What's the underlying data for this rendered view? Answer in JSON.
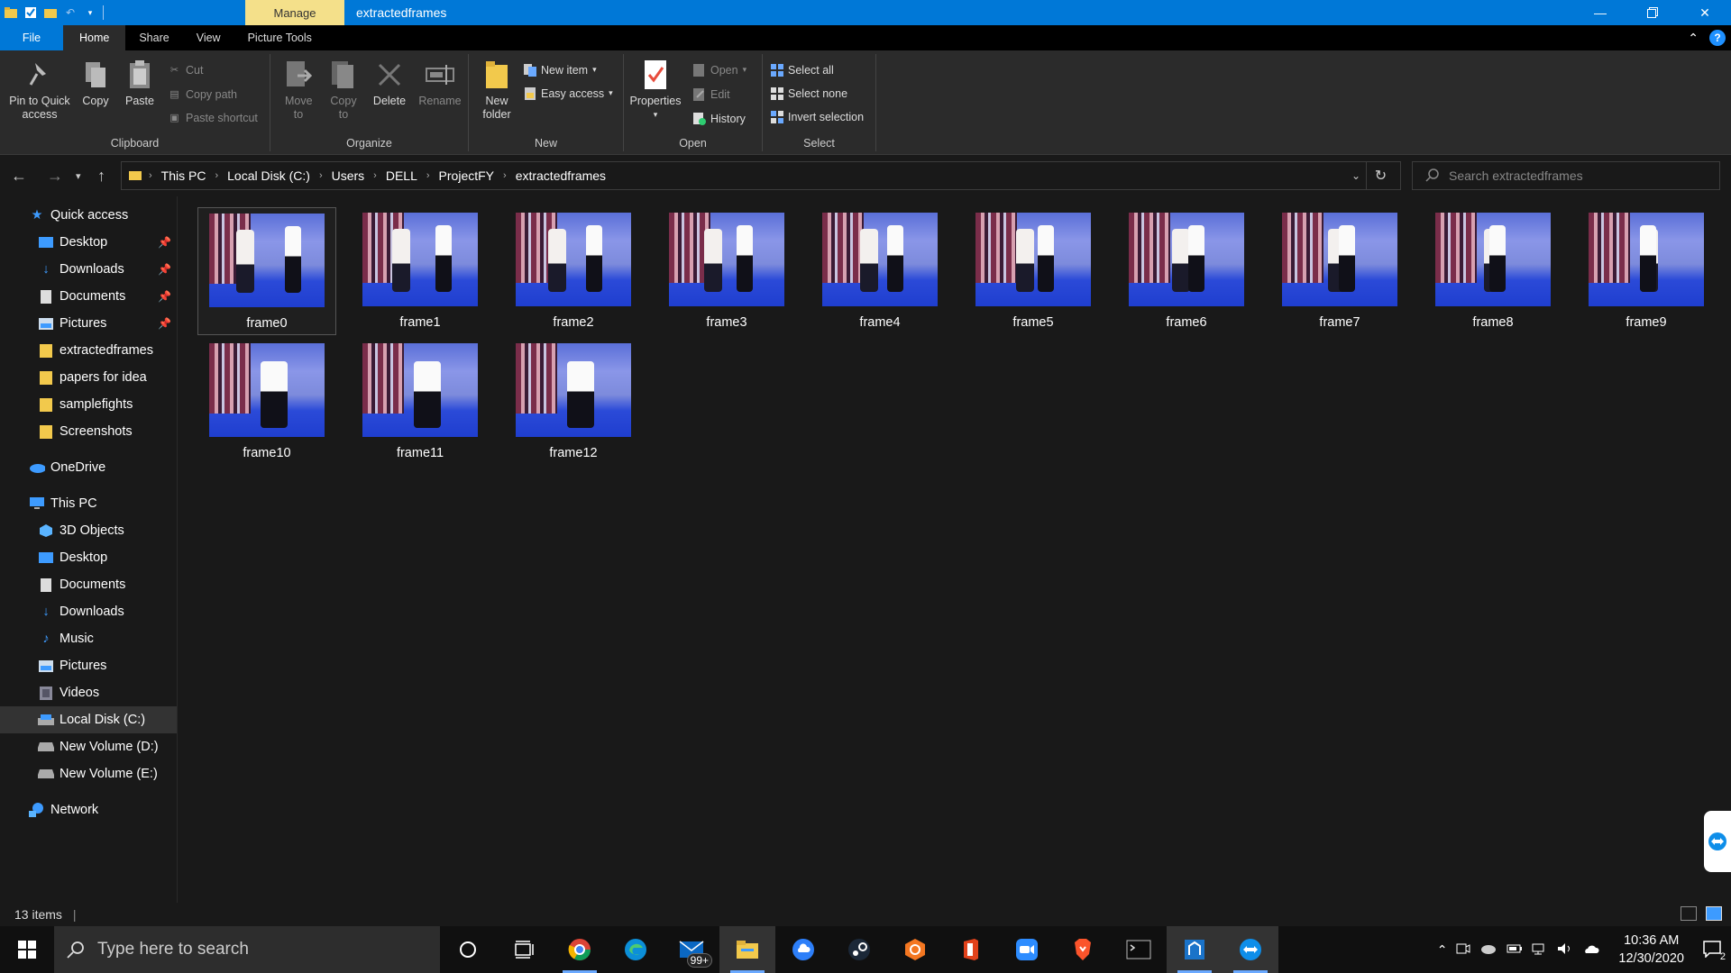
{
  "titlebar": {
    "manage_label": "Manage",
    "title": "extractedframes"
  },
  "ribbon_tabs": [
    "File",
    "Home",
    "Share",
    "View",
    "Picture Tools"
  ],
  "ribbon": {
    "clipboard": {
      "pin_label": "Pin to Quick access",
      "copy_label": "Copy",
      "paste_label": "Paste",
      "cut_label": "Cut",
      "copy_path_label": "Copy path",
      "paste_shortcut_label": "Paste shortcut",
      "group_label": "Clipboard"
    },
    "organize": {
      "move_to_label": "Move to",
      "copy_to_label": "Copy to",
      "delete_label": "Delete",
      "rename_label": "Rename",
      "group_label": "Organize"
    },
    "new": {
      "new_folder_label": "New folder",
      "new_item_label": "New item",
      "easy_access_label": "Easy access",
      "group_label": "New"
    },
    "open": {
      "properties_label": "Properties",
      "open_label": "Open",
      "edit_label": "Edit",
      "history_label": "History",
      "group_label": "Open"
    },
    "select": {
      "select_all_label": "Select all",
      "select_none_label": "Select none",
      "invert_label": "Invert selection",
      "group_label": "Select"
    }
  },
  "address": {
    "crumbs": [
      "This PC",
      "Local Disk (C:)",
      "Users",
      "DELL",
      "ProjectFY",
      "extractedframes"
    ],
    "search_placeholder": "Search extractedframes"
  },
  "navpane": {
    "quick_access": "Quick access",
    "quick_items": [
      "Desktop",
      "Downloads",
      "Documents",
      "Pictures",
      "extractedframes",
      "papers for idea",
      "samplefights",
      "Screenshots"
    ],
    "onedrive": "OneDrive",
    "this_pc": "This PC",
    "pc_items": [
      "3D Objects",
      "Desktop",
      "Documents",
      "Downloads",
      "Music",
      "Pictures",
      "Videos",
      "Local Disk (C:)",
      "New Volume (D:)",
      "New Volume (E:)"
    ],
    "network": "Network"
  },
  "files": [
    "frame0",
    "frame1",
    "frame2",
    "frame3",
    "frame4",
    "frame5",
    "frame6",
    "frame7",
    "frame8",
    "frame9",
    "frame10",
    "frame11",
    "frame12"
  ],
  "status": {
    "items_count": "13 items"
  },
  "taskbar": {
    "search_placeholder": "Type here to search",
    "mail_badge": "99+",
    "time": "10:36 AM",
    "date": "12/30/2020",
    "notification_count": "2"
  },
  "colors": {
    "accent": "#0078d7",
    "manage_tab": "#f4e08a",
    "background": "#191919",
    "ribbon": "#2b2b2b"
  }
}
